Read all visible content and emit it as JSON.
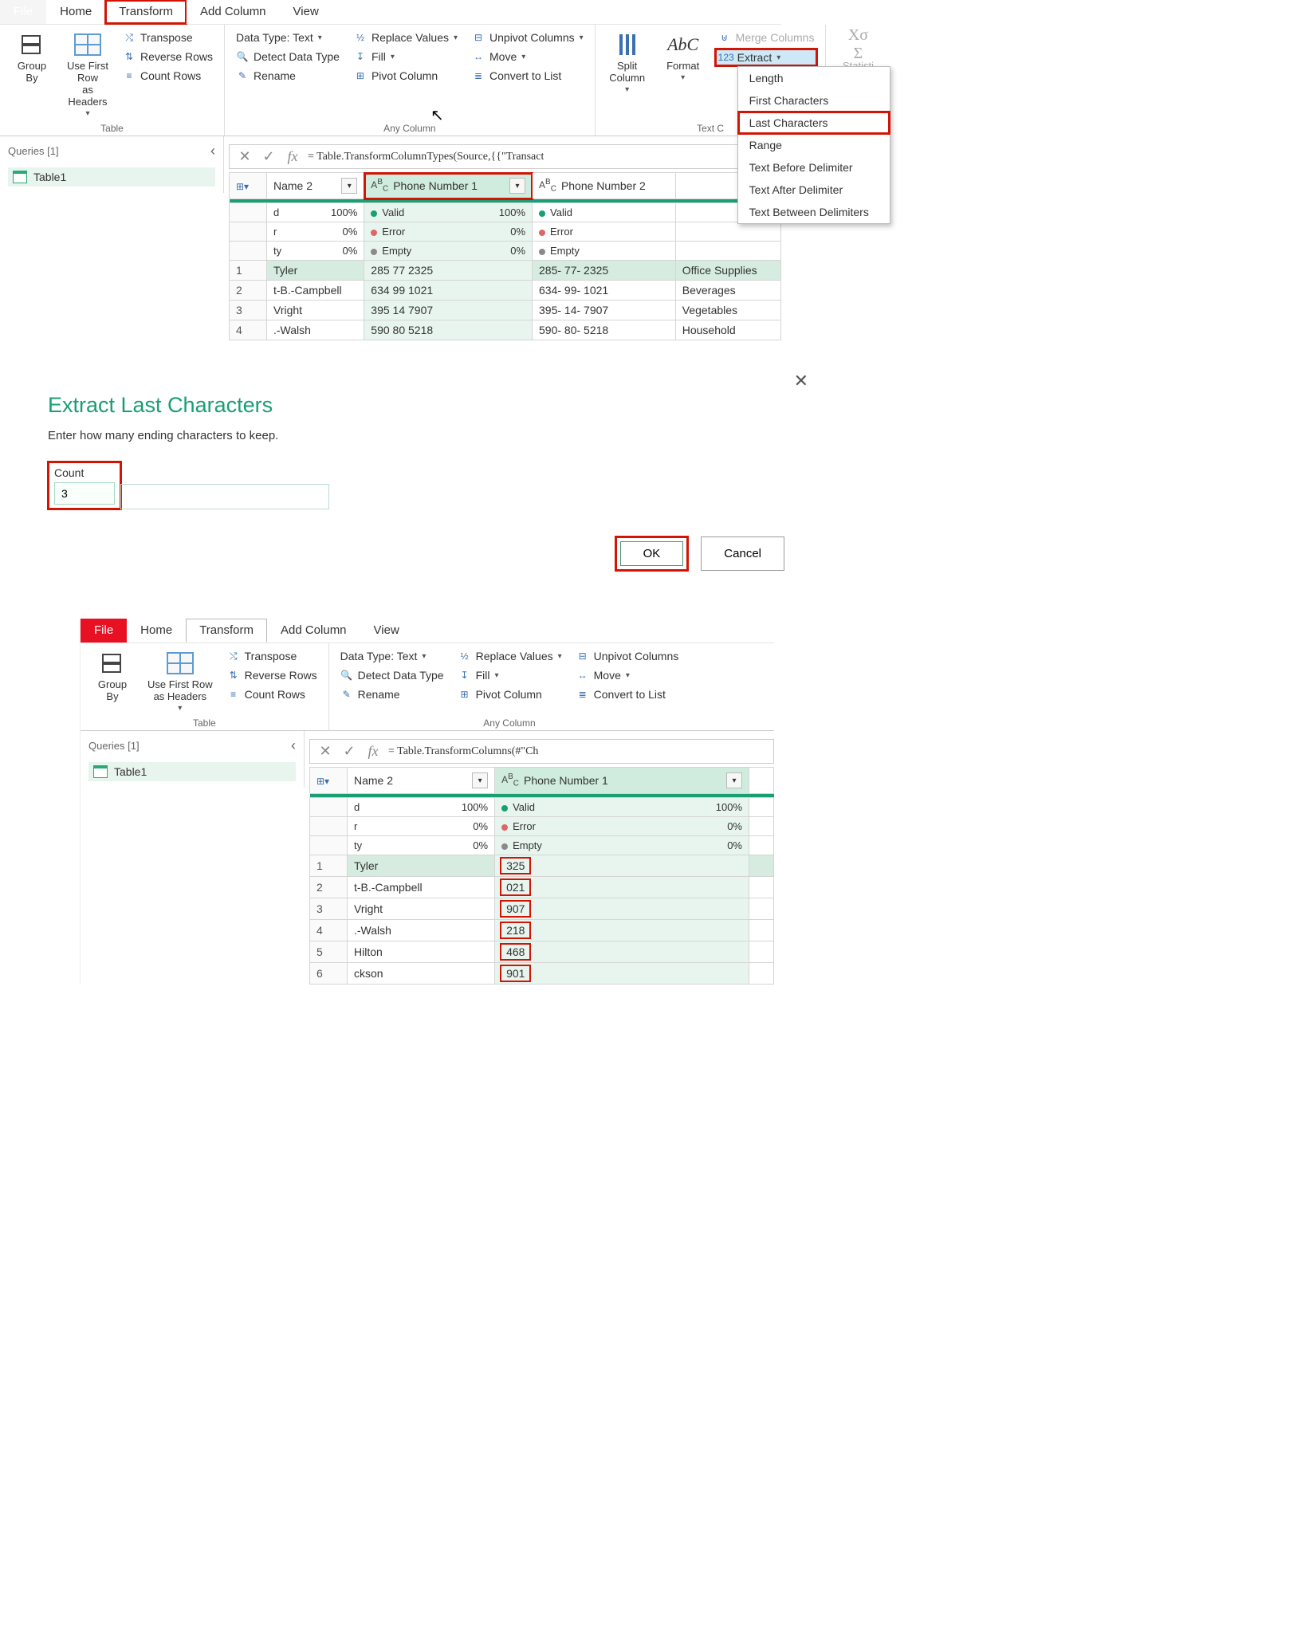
{
  "pane1": {
    "tabs": {
      "file": "File",
      "home": "Home",
      "transform": "Transform",
      "addcol": "Add Column",
      "view": "View"
    },
    "ribbon": {
      "groupBy": "Group\nBy",
      "useFirstRow": "Use First Row\nas Headers",
      "transpose": "Transpose",
      "reverseRows": "Reverse Rows",
      "countRows": "Count Rows",
      "tableGroup": "Table",
      "dataType": "Data Type: Text",
      "detect": "Detect Data Type",
      "rename": "Rename",
      "replace": "Replace Values",
      "fill": "Fill",
      "pivot": "Pivot Column",
      "unpivot": "Unpivot Columns",
      "move": "Move",
      "convert": "Convert to List",
      "anyColGroup": "Any Column",
      "split": "Split\nColumn",
      "format": "Format",
      "merge": "Merge Columns",
      "extract": "Extract",
      "textColGroup": "Text C",
      "stats": "Statisti"
    },
    "extract_menu": {
      "length": "Length",
      "first": "First Characters",
      "last": "Last Characters",
      "range": "Range",
      "before": "Text Before Delimiter",
      "after": "Text After Delimiter",
      "between": "Text Between Delimiters"
    },
    "queries": {
      "header": "Queries [1]",
      "item": "Table1"
    },
    "formula": "= Table.TransformColumnTypes(Source,{{\"Transact",
    "columns": {
      "name": "Name 2",
      "phone1": "Phone Number 1",
      "phone2": "Phone Number 2",
      "cat": ""
    },
    "quality": {
      "valid": "Valid",
      "error": "Error",
      "empty": "Empty",
      "p100": "100%",
      "p0": "0%",
      "c1a": "d",
      "c1b": "r",
      "c1c": "ty"
    },
    "rows": [
      {
        "n": "1",
        "name": "Tyler",
        "p1": "285 77 2325",
        "p2": "285- 77- 2325",
        "cat": "Office Supplies"
      },
      {
        "n": "2",
        "name": "t-B.-Campbell",
        "p1": "634 99 1021",
        "p2": "634- 99- 1021",
        "cat": "Beverages"
      },
      {
        "n": "3",
        "name": "Vright",
        "p1": "395 14 7907",
        "p2": "395- 14- 7907",
        "cat": "Vegetables"
      },
      {
        "n": "4",
        "name": ".-Walsh",
        "p1": "590 80 5218",
        "p2": "590- 80- 5218",
        "cat": "Household"
      }
    ]
  },
  "dialog": {
    "title": "Extract Last Characters",
    "subtitle": "Enter how many ending characters to keep.",
    "count_label": "Count",
    "count_value": "3",
    "ok": "OK",
    "cancel": "Cancel"
  },
  "pane3": {
    "tabs": {
      "file": "File",
      "home": "Home",
      "transform": "Transform",
      "addcol": "Add Column",
      "view": "View"
    },
    "ribbon": {
      "groupBy": "Group\nBy",
      "useFirstRow": "Use First Row\nas Headers",
      "transpose": "Transpose",
      "reverseRows": "Reverse Rows",
      "countRows": "Count Rows",
      "tableGroup": "Table",
      "dataType": "Data Type: Text",
      "detect": "Detect Data Type",
      "rename": "Rename",
      "replace": "Replace Values",
      "fill": "Fill",
      "pivot": "Pivot Column",
      "unpivot": "Unpivot Columns",
      "move": "Move",
      "convert": "Convert to List",
      "anyColGroup": "Any Column"
    },
    "queries": {
      "header": "Queries [1]",
      "item": "Table1"
    },
    "formula": "= Table.TransformColumns(#\"Ch",
    "columns": {
      "name": "Name 2",
      "phone1": "Phone Number 1"
    },
    "quality": {
      "valid": "Valid",
      "error": "Error",
      "empty": "Empty",
      "p100": "100%",
      "p0": "0%",
      "c1a": "d",
      "c1b": "r",
      "c1c": "ty"
    },
    "rows": [
      {
        "n": "1",
        "name": "Tyler",
        "p1": "325"
      },
      {
        "n": "2",
        "name": "t-B.-Campbell",
        "p1": "021"
      },
      {
        "n": "3",
        "name": "Vright",
        "p1": "907"
      },
      {
        "n": "4",
        "name": ".-Walsh",
        "p1": "218"
      },
      {
        "n": "5",
        "name": "Hilton",
        "p1": "468"
      },
      {
        "n": "6",
        "name": "ckson",
        "p1": "901"
      }
    ]
  }
}
